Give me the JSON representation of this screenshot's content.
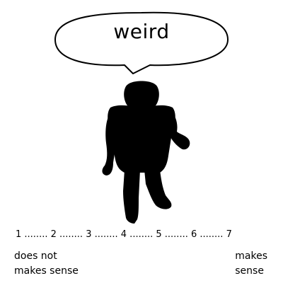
{
  "bubble": {
    "word": "weird"
  },
  "scale": {
    "text": "1 ........ 2 ........ 3 ........ 4 ........ 5 ........ 6 ........ 7",
    "left_label_line1": "does not",
    "left_label_line2": "makes sense",
    "right_label_line1": "makes",
    "right_label_line2": "sense"
  },
  "figure": {
    "icon": "robot-silhouette-icon",
    "color": "#000000"
  }
}
